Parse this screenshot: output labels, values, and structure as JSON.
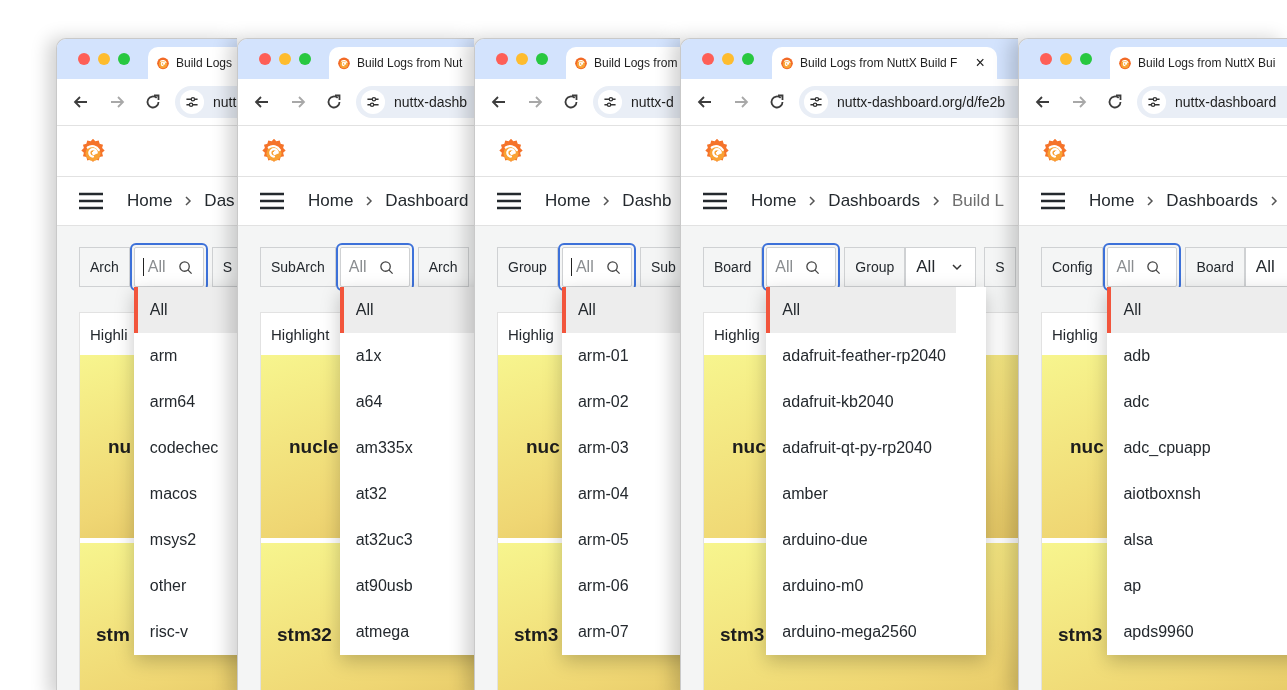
{
  "windows": [
    {
      "tab_title": "Build Logs",
      "url": "nutt",
      "breadcrumbs": [
        {
          "label": "Home",
          "current": false
        },
        {
          "label": "Das",
          "current": false
        }
      ],
      "filters": [
        {
          "kind": "label",
          "label": "Arch"
        },
        {
          "kind": "search",
          "placeholder": "All",
          "focused": true,
          "caret": true,
          "options": [
            {
              "label": "All",
              "selected": true
            },
            {
              "label": "arm",
              "selected": false
            },
            {
              "label": "arm64",
              "selected": false
            },
            {
              "label": "codechec",
              "selected": false
            },
            {
              "label": "macos",
              "selected": false
            },
            {
              "label": "msys2",
              "selected": false
            },
            {
              "label": "other",
              "selected": false
            },
            {
              "label": "risc-v",
              "selected": false
            }
          ]
        },
        {
          "kind": "label",
          "label": "S"
        }
      ],
      "panel": {
        "title": "Highli",
        "cells": [
          "nu",
          "stm"
        ]
      }
    },
    {
      "tab_title": "Build Logs from Nut",
      "url": "nuttx-dashb",
      "breadcrumbs": [
        {
          "label": "Home",
          "current": false
        },
        {
          "label": "Dashboard",
          "current": false
        }
      ],
      "filters": [
        {
          "kind": "label",
          "label": "SubArch"
        },
        {
          "kind": "search",
          "placeholder": "All",
          "focused": true,
          "caret": false,
          "options": [
            {
              "label": "All",
              "selected": true
            },
            {
              "label": "a1x",
              "selected": false
            },
            {
              "label": "a64",
              "selected": false
            },
            {
              "label": "am335x",
              "selected": false
            },
            {
              "label": "at32",
              "selected": false
            },
            {
              "label": "at32uc3",
              "selected": false
            },
            {
              "label": "at90usb",
              "selected": false
            },
            {
              "label": "atmega",
              "selected": false
            }
          ]
        },
        {
          "kind": "label",
          "label": "Arch"
        }
      ],
      "panel": {
        "title": "Highlight",
        "cells": [
          "nucle",
          "stm32"
        ]
      }
    },
    {
      "tab_title": "Build Logs from",
      "url": "nuttx-d",
      "breadcrumbs": [
        {
          "label": "Home",
          "current": false
        },
        {
          "label": "Dashb",
          "current": false
        }
      ],
      "filters": [
        {
          "kind": "label",
          "label": "Group"
        },
        {
          "kind": "search",
          "placeholder": "All",
          "focused": true,
          "caret": true,
          "options": [
            {
              "label": "All",
              "selected": true
            },
            {
              "label": "arm-01",
              "selected": false
            },
            {
              "label": "arm-02",
              "selected": false
            },
            {
              "label": "arm-03",
              "selected": false
            },
            {
              "label": "arm-04",
              "selected": false
            },
            {
              "label": "arm-05",
              "selected": false
            },
            {
              "label": "arm-06",
              "selected": false
            },
            {
              "label": "arm-07",
              "selected": false
            }
          ]
        },
        {
          "kind": "label",
          "label": "Sub"
        }
      ],
      "panel": {
        "title": "Highlig",
        "cells": [
          "nuc",
          "stm3"
        ]
      }
    },
    {
      "tab_title": "Build Logs from NuttX Build F",
      "tab_close": "×",
      "url": "nuttx-dashboard.org/d/fe2b",
      "breadcrumbs": [
        {
          "label": "Home",
          "current": false
        },
        {
          "label": "Dashboards",
          "current": false
        },
        {
          "label": "Build L",
          "current": true
        }
      ],
      "filters": [
        {
          "kind": "label",
          "label": "Board"
        },
        {
          "kind": "search",
          "placeholder": "All",
          "focused": true,
          "caret": false,
          "options": [
            {
              "label": "All",
              "selected": true
            },
            {
              "label": "adafruit-feather-rp2040",
              "selected": false
            },
            {
              "label": "adafruit-kb2040",
              "selected": false
            },
            {
              "label": "adafruit-qt-py-rp2040",
              "selected": false
            },
            {
              "label": "amber",
              "selected": false
            },
            {
              "label": "arduino-due",
              "selected": false
            },
            {
              "label": "arduino-m0",
              "selected": false
            },
            {
              "label": "arduino-mega2560",
              "selected": false
            }
          ]
        },
        {
          "kind": "label",
          "label": "Group"
        },
        {
          "kind": "select",
          "value": "All"
        },
        {
          "kind": "label",
          "label": "S"
        }
      ],
      "panel": {
        "title": "Highlig",
        "cells": [
          "nuc",
          "stm3"
        ]
      }
    },
    {
      "tab_title": "Build Logs from NuttX Bui",
      "url": "nuttx-dashboard",
      "breadcrumbs": [
        {
          "label": "Home",
          "current": false
        },
        {
          "label": "Dashboards",
          "current": false
        }
      ],
      "trailing_separator": true,
      "filters": [
        {
          "kind": "label",
          "label": "Config"
        },
        {
          "kind": "search",
          "placeholder": "All",
          "focused": true,
          "caret": false,
          "options": [
            {
              "label": "All",
              "selected": true
            },
            {
              "label": "adb",
              "selected": false
            },
            {
              "label": "adc",
              "selected": false
            },
            {
              "label": "adc_cpuapp",
              "selected": false
            },
            {
              "label": "aiotboxnsh",
              "selected": false
            },
            {
              "label": "alsa",
              "selected": false
            },
            {
              "label": "ap",
              "selected": false
            },
            {
              "label": "apds9960",
              "selected": false
            }
          ]
        },
        {
          "kind": "label",
          "label": "Board"
        },
        {
          "kind": "select",
          "value": "All"
        }
      ],
      "panel": {
        "title": "Highlig",
        "cells": [
          "nuc",
          "stm3"
        ]
      }
    }
  ]
}
